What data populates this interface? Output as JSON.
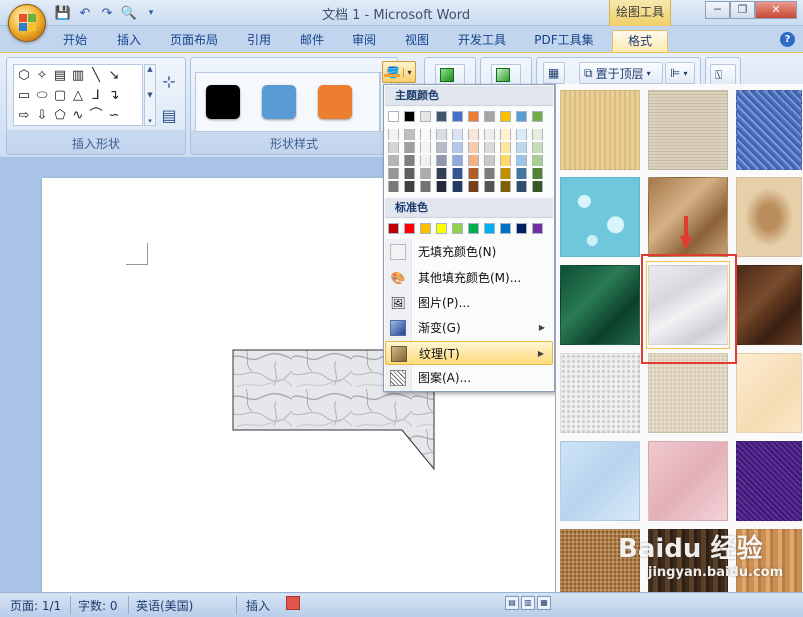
{
  "window": {
    "title": "文档 1 - Microsoft Word",
    "contextual_tab": "绘图工具",
    "minimize": "─",
    "restore": "❐",
    "close": "✕"
  },
  "tabs": [
    {
      "label": "开始"
    },
    {
      "label": "插入"
    },
    {
      "label": "页面布局"
    },
    {
      "label": "引用"
    },
    {
      "label": "邮件"
    },
    {
      "label": "审阅"
    },
    {
      "label": "视图"
    },
    {
      "label": "开发工具"
    },
    {
      "label": "PDF工具集"
    },
    {
      "label": "格式",
      "active": true
    }
  ],
  "ribbon": {
    "insert_shapes_label": "插入形状",
    "shape_styles_label": "形状样式",
    "bring_to_front": "置于顶层",
    "style_colors": [
      "#000000",
      "#5b9bd5",
      "#ed7d31"
    ]
  },
  "fill_menu": {
    "theme_colors_header": "主题颜色",
    "standard_colors_header": "标准色",
    "theme_top_row": [
      "#ffffff",
      "#000000",
      "#e7e6e6",
      "#44546a",
      "#4472c4",
      "#ed7d31",
      "#a5a5a5",
      "#ffc000",
      "#5b9bd5",
      "#70ad47"
    ],
    "standard_colors": [
      "#c00000",
      "#ff0000",
      "#ffc000",
      "#ffff00",
      "#92d050",
      "#00b050",
      "#00b0f0",
      "#0070c0",
      "#002060",
      "#7030a0"
    ],
    "items": [
      {
        "label": "无填充颜色(N)",
        "icon": "no-fill-icon"
      },
      {
        "label": "其他填充颜色(M)...",
        "icon": "palette-icon"
      },
      {
        "label": "图片(P)...",
        "icon": "picture-icon"
      },
      {
        "label": "渐变(G)",
        "icon": "gradient-icon",
        "submenu": true
      },
      {
        "label": "纹理(T)",
        "icon": "texture-icon",
        "submenu": true,
        "highlighted": true
      },
      {
        "label": "图案(A)...",
        "icon": "pattern-icon"
      }
    ]
  },
  "textures": [
    "papyrus",
    "canvas",
    "denim",
    "water-droplets",
    "paper-bag",
    "fish-fossil",
    "green-marble",
    "white-marble",
    "brown-marble",
    "granite",
    "sand",
    "parchment",
    "blue-tissue-paper",
    "pink-tissue-paper",
    "purple-mesh",
    "cork",
    "walnut",
    "oak"
  ],
  "selected_texture": "white-marble",
  "watermark": {
    "brand": "Baidu 经验",
    "url": "jingyan.baidu.com"
  },
  "statusbar": {
    "page": "页面: 1/1",
    "words": "字数: 0",
    "language": "英语(美国)",
    "mode": "插入"
  }
}
